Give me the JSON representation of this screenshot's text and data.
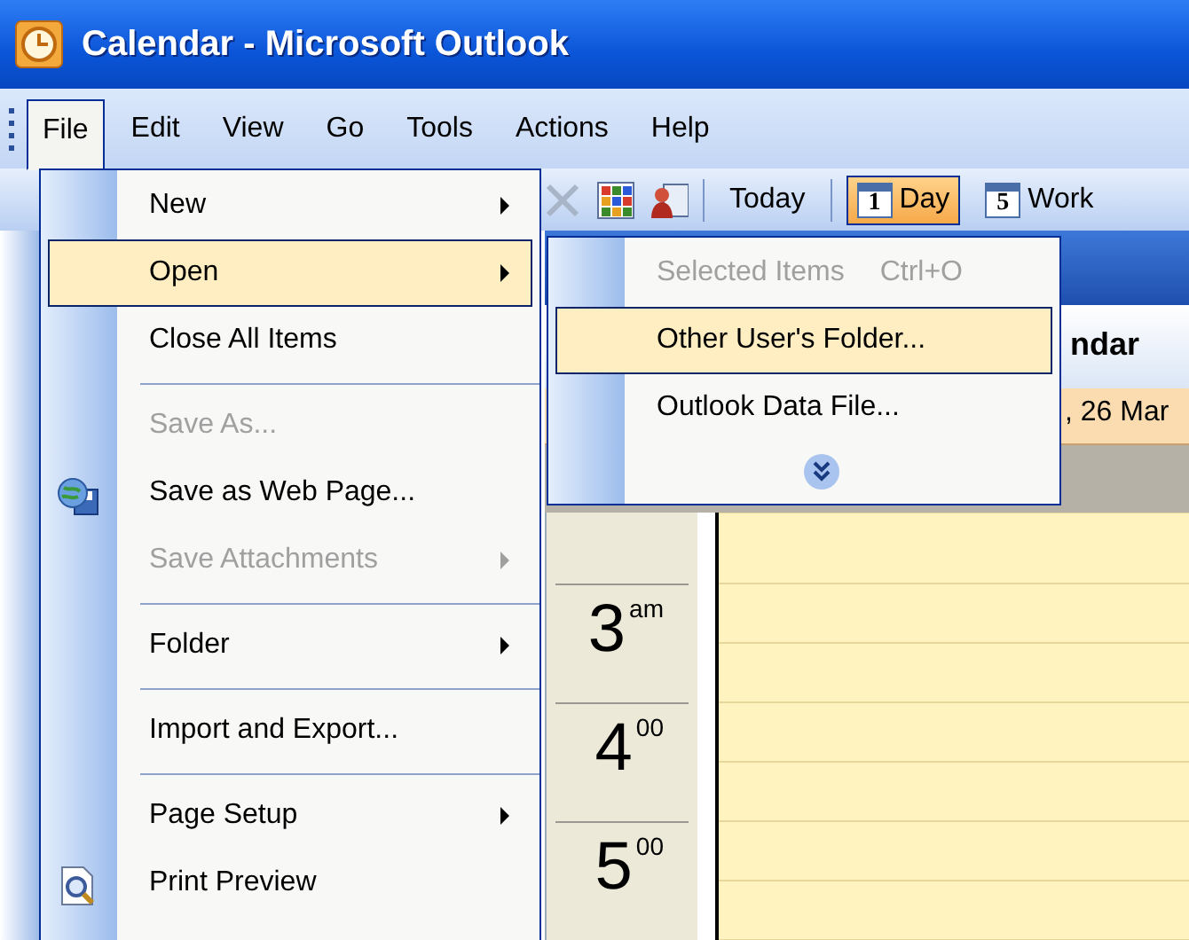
{
  "window": {
    "title": "Calendar - Microsoft Outlook"
  },
  "menu_bar": [
    {
      "label": "File",
      "selected": true
    },
    {
      "label": "Edit",
      "selected": false
    },
    {
      "label": "View",
      "selected": false
    },
    {
      "label": "Go",
      "selected": false
    },
    {
      "label": "Tools",
      "selected": false
    },
    {
      "label": "Actions",
      "selected": false
    },
    {
      "label": "Help",
      "selected": false
    }
  ],
  "toolbar": [
    {
      "kind": "icon"
    },
    {
      "kind": "icon"
    },
    {
      "kind": "icon"
    },
    {
      "kind": "separator"
    },
    {
      "kind": "button",
      "label": "Today",
      "selected": false
    },
    {
      "kind": "separator"
    },
    {
      "kind": "button",
      "badge": "1",
      "label": "Day",
      "selected": true
    },
    {
      "kind": "button",
      "badge": "5",
      "label": "Work",
      "selected": false
    }
  ],
  "file_menu": [
    {
      "kind": "item",
      "label": "New",
      "submenu": true,
      "disabled": false,
      "selected": false
    },
    {
      "kind": "item",
      "label": "Open",
      "submenu": true,
      "disabled": false,
      "selected": true
    },
    {
      "kind": "item",
      "label": "Close All Items",
      "submenu": false,
      "disabled": false,
      "selected": false
    },
    {
      "kind": "separator"
    },
    {
      "kind": "item",
      "label": "Save As...",
      "submenu": false,
      "disabled": true,
      "selected": false
    },
    {
      "kind": "item",
      "label": "Save as Web Page...",
      "submenu": false,
      "disabled": false,
      "selected": false
    },
    {
      "kind": "item",
      "label": "Save Attachments",
      "submenu": true,
      "disabled": true,
      "selected": false
    },
    {
      "kind": "separator"
    },
    {
      "kind": "item",
      "label": "Folder",
      "submenu": true,
      "disabled": false,
      "selected": false
    },
    {
      "kind": "separator"
    },
    {
      "kind": "item",
      "label": "Import and Export...",
      "submenu": false,
      "disabled": false,
      "selected": false
    },
    {
      "kind": "separator"
    },
    {
      "kind": "item",
      "label": "Page Setup",
      "submenu": true,
      "disabled": false,
      "selected": false
    },
    {
      "kind": "item",
      "label": "Print Preview",
      "submenu": false,
      "disabled": false,
      "selected": false
    }
  ],
  "open_submenu": [
    {
      "kind": "item",
      "label": "Selected Items",
      "shortcut": "Ctrl+O",
      "submenu": false,
      "disabled": true,
      "selected": false
    },
    {
      "kind": "item",
      "label": "Other User's Folder...",
      "submenu": false,
      "disabled": false,
      "selected": true
    },
    {
      "kind": "item",
      "label": "Outlook Data File...",
      "submenu": false,
      "disabled": false,
      "selected": false
    },
    {
      "kind": "more"
    }
  ],
  "calendar": {
    "title": "ndar",
    "date": ", 26 Mar",
    "hours": [
      {
        "hour": "3",
        "suffix": "am"
      },
      {
        "hour": "4",
        "suffix": "00"
      },
      {
        "hour": "5",
        "suffix": "00"
      }
    ]
  }
}
